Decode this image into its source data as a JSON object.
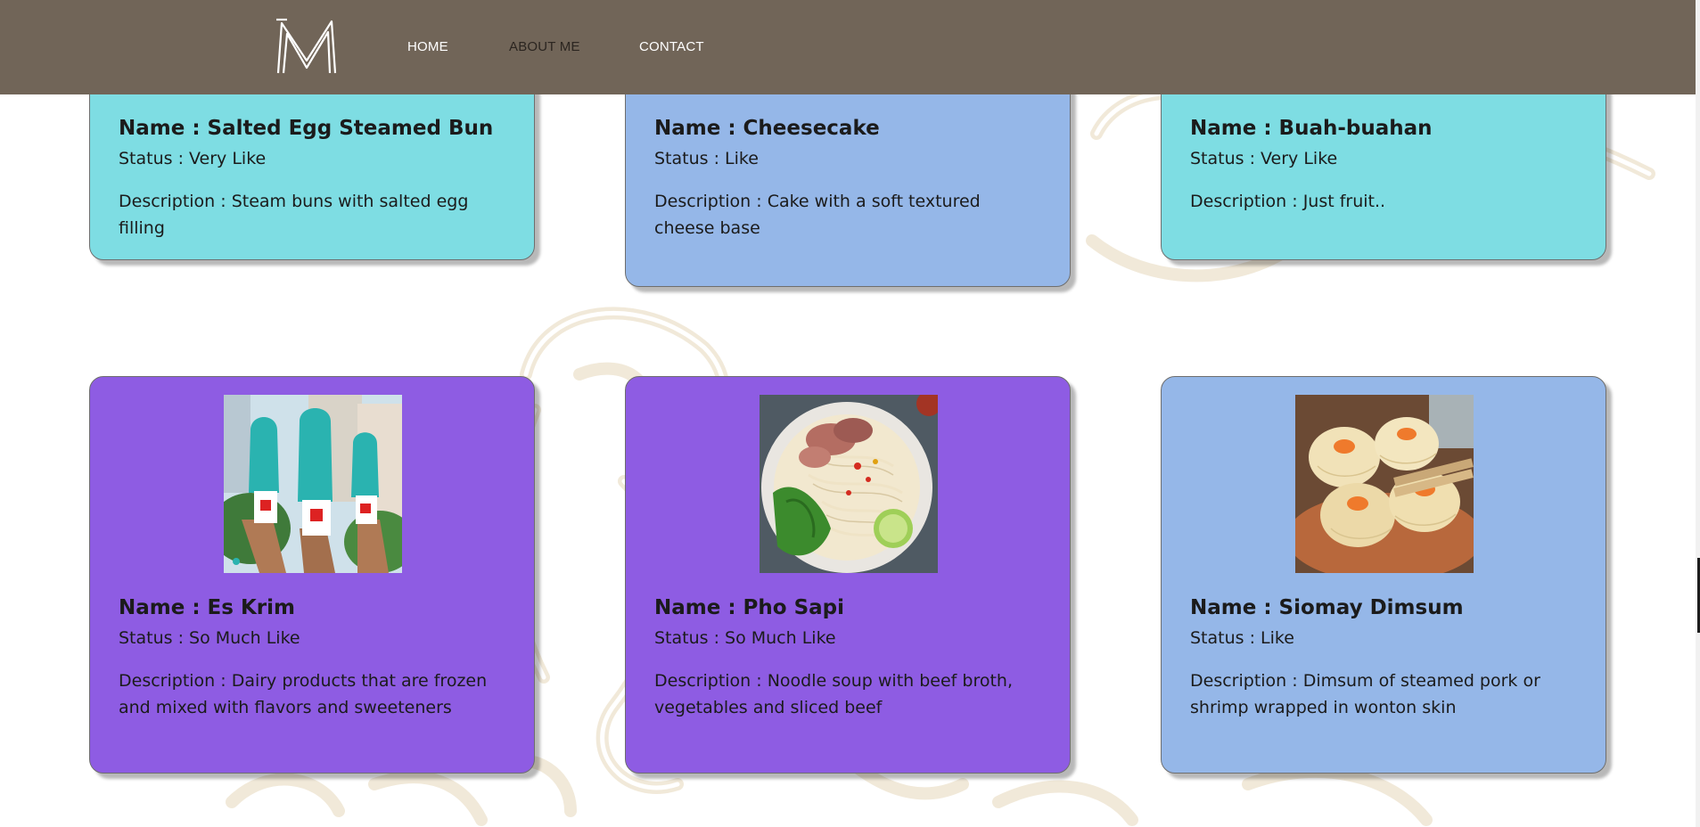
{
  "colors": {
    "navbar": "#716558",
    "card_cyan": "#7edde3",
    "card_blue": "#95b7e8",
    "card_purple": "#8e5ce3"
  },
  "nav": {
    "logo_icon": "m-logo-icon",
    "links": [
      {
        "label": "HOME"
      },
      {
        "label": "ABOUT ME"
      },
      {
        "label": "CONTACT"
      }
    ]
  },
  "cards": [
    {
      "name": "Name : Salted Egg Steamed Bun",
      "status": "Status : Very Like",
      "description": "Description : Steam buns with salted egg filling",
      "color": "cyan"
    },
    {
      "name": "Name : Cheesecake",
      "status": "Status : Like",
      "description": "Description : Cake with a soft textured cheese base",
      "color": "blue"
    },
    {
      "name": "Name : Buah-buahan",
      "status": "Status : Very Like",
      "description": "Description : Just fruit..",
      "color": "cyan"
    },
    {
      "name": "Name : Es Krim",
      "status": "Status : So Much Like",
      "description": "Description : Dairy products that are frozen and mixed with flavors and sweeteners",
      "color": "purple",
      "image_icon": "ice-cream-photo"
    },
    {
      "name": "Name : Pho Sapi",
      "status": "Status : So Much Like",
      "description": "Description : Noodle soup with beef broth, vegetables and sliced beef",
      "color": "purple",
      "image_icon": "pho-bowl-photo"
    },
    {
      "name": "Name : Siomay Dimsum",
      "status": "Status : Like",
      "description": "Description : Dimsum of steamed pork or shrimp wrapped in wonton skin",
      "color": "blue",
      "image_icon": "dimsum-photo"
    }
  ]
}
